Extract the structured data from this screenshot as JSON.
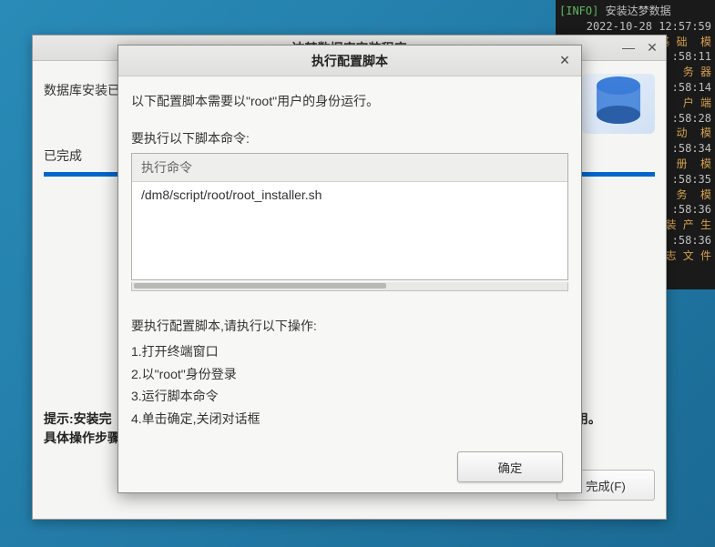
{
  "terminal": {
    "lines": [
      {
        "tag": "[INFO]",
        "text": " 安装达梦数据"
      },
      {
        "text": "2022-10-28 12:57:59"
      },
      {
        "text": "装   基 础  模",
        "cn": true
      },
      {
        "text": ":58:11"
      },
      {
        "text": "务 器",
        "cn": true
      },
      {
        "text": ":58:14"
      },
      {
        "text": "户 端",
        "cn": true
      },
      {
        "text": ":58:28"
      },
      {
        "text": "动  模",
        "cn": true
      },
      {
        "text": ":58:34"
      },
      {
        "text": "册  模",
        "cn": true
      },
      {
        "text": ":58:35"
      },
      {
        "text": "务  模",
        "cn": true
      },
      {
        "text": ":58:36"
      },
      {
        "text": "装 产 生",
        "cn": true
      },
      {
        "text": ":58:36"
      },
      {
        "text": "志 文 件",
        "cn": true
      }
    ]
  },
  "installer": {
    "title": "达梦数据库安装程序",
    "header_label": "数据库安装已",
    "progress_label": "已完成",
    "footer_line1": "提示:安装完成后，……正常使用。",
    "footer_line2": "具体操作步骤",
    "finish_button": "完成(F)"
  },
  "modal": {
    "title": "执行配置脚本",
    "intro": "以下配置脚本需要以\"root\"用户的身份运行。",
    "cmd_label": "要执行以下脚本命令:",
    "cmd_header": "执行命令",
    "cmd_value": "/dm8/script/root/root_installer.sh",
    "steps_label": "要执行配置脚本,请执行以下操作:",
    "steps": [
      "1.打开终端窗口",
      "2.以\"root\"身份登录",
      "3.运行脚本命令",
      "4.单击确定,关闭对话框"
    ],
    "ok_button": "确定"
  }
}
